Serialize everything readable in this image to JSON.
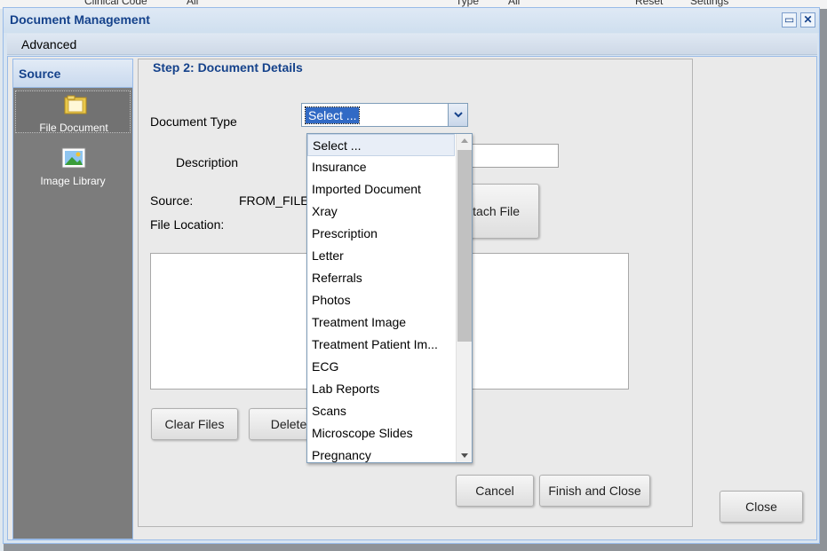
{
  "background": {
    "clinical_code_label": "Clinical Code",
    "clinical_code_value": "All",
    "type_label": "Type",
    "type_value": "All",
    "reset": "Reset",
    "settings": "Settings"
  },
  "window": {
    "title": "Document Management"
  },
  "menu": {
    "advanced": "Advanced"
  },
  "source": {
    "title": "Source",
    "items": [
      {
        "label": "File Document",
        "icon": "folder-icon"
      },
      {
        "label": "Image Library",
        "icon": "image-icon"
      }
    ]
  },
  "step": {
    "title": "Step 2: Document Details"
  },
  "form": {
    "document_type_label": "Document Type",
    "document_type_value": "Select ...",
    "description_label": "Description",
    "source_label": "Source:",
    "source_value": "FROM_FILE",
    "file_location_label": "File Location:"
  },
  "buttons": {
    "attach_file": "Attach File",
    "clear_files": "Clear Files",
    "delete": "Delete",
    "cancel": "Cancel",
    "finish_and_close": "Finish and Close",
    "close": "Close"
  },
  "dropdown_options": [
    "Select ...",
    "Insurance",
    "Imported Document",
    "Xray",
    "Prescription",
    "Letter",
    "Referrals",
    "Photos",
    "Treatment Image",
    "Treatment Patient Im...",
    "ECG",
    "Lab Reports",
    "Scans",
    "Microscope Slides",
    "Pregnancy"
  ],
  "colors": {
    "title_blue": "#15428b",
    "selection_blue": "#316ac5",
    "sidebar_gray": "#7c7c7c"
  }
}
